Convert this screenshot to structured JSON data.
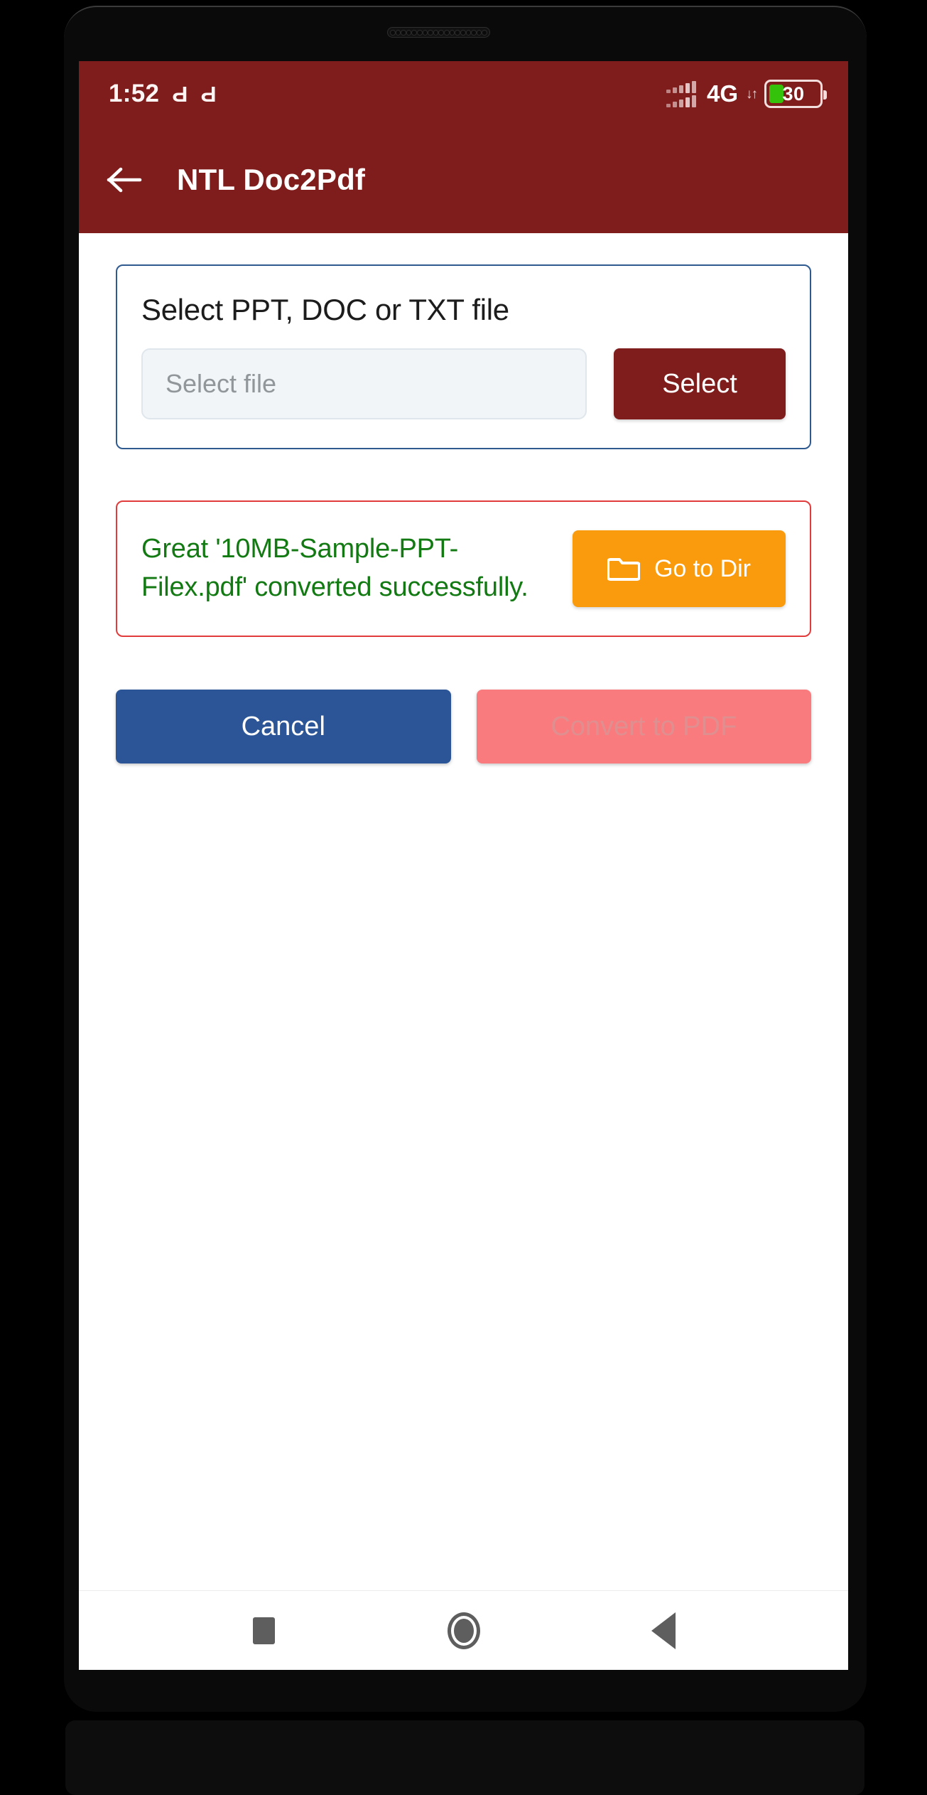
{
  "status_bar": {
    "clock": "1:52",
    "notification_icons": [
      "Ԁ",
      "Ԁ"
    ],
    "network_type": "4G",
    "data_arrows": "↓↑",
    "battery_level": "30",
    "battery_percent": 30,
    "signal_icon": "signal-bars-icon",
    "background_color": "#7f1d1d"
  },
  "app_bar": {
    "back_icon": "back-arrow-icon",
    "title": "NTL Doc2Pdf",
    "background_color": "#7f1d1d"
  },
  "file_card": {
    "label": "Select PPT, DOC or TXT file",
    "input_value": "",
    "input_placeholder": "Select file",
    "select_button_label": "Select",
    "select_button_color": "#7f1d1d",
    "border_color": "#2e5a8f"
  },
  "result_card": {
    "message": "Great '10MB-Sample-PPT-Filex.pdf' converted successfully.",
    "message_color": "#137a13",
    "border_color": "#e23b3b",
    "go_to_dir_label": "Go to Dir",
    "go_to_dir_icon": "folder-icon",
    "go_to_dir_color": "#f99b0c"
  },
  "actions": {
    "cancel_label": "Cancel",
    "cancel_color": "#2b5596",
    "convert_label": "Convert to PDF",
    "convert_color": "#fa7b7e",
    "convert_enabled": false
  },
  "nav_bar": {
    "recents_icon": "square-recents-icon",
    "home_icon": "circle-home-icon",
    "back_icon": "triangle-back-icon"
  }
}
